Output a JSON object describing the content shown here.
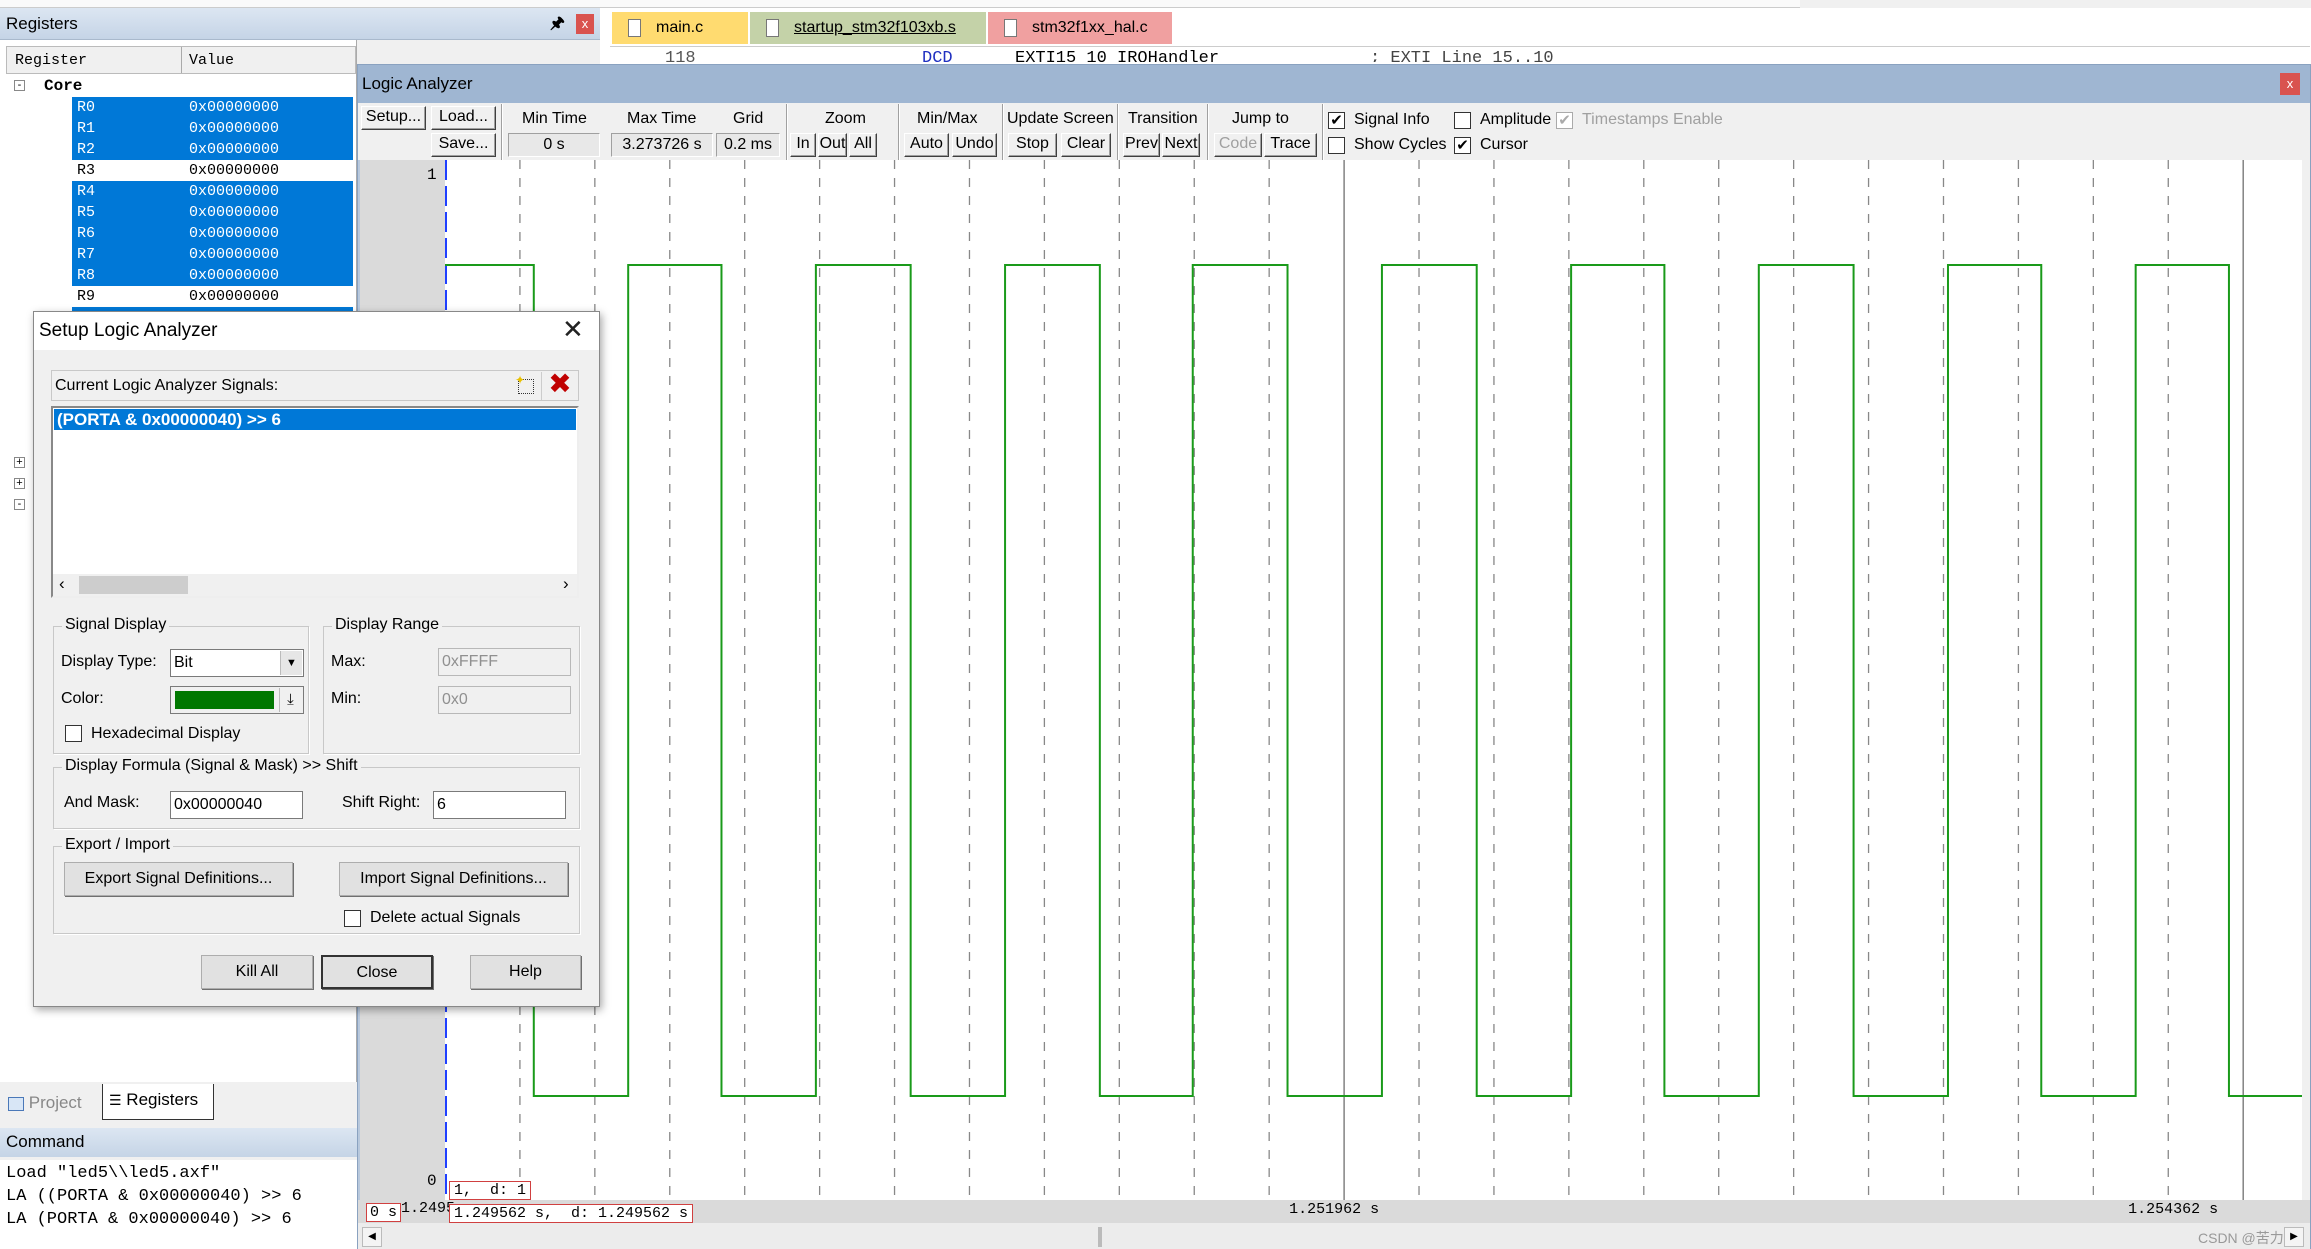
{
  "colors": {
    "selection": "#0078d7",
    "signal": "#1a9a1a",
    "panel_title": "#9fb6d2",
    "close_red": "#d9534f",
    "cursor_box": "#d04040"
  },
  "registers_panel": {
    "title": "Registers",
    "columns": [
      "Register",
      "Value"
    ],
    "group": "Core",
    "rows": [
      {
        "name": "R0",
        "value": "0x00000000",
        "selected": true
      },
      {
        "name": "R1",
        "value": "0x00000000",
        "selected": true
      },
      {
        "name": "R2",
        "value": "0x00000000",
        "selected": true
      },
      {
        "name": "R3",
        "value": "0x00000000",
        "selected": false
      },
      {
        "name": "R4",
        "value": "0x00000000",
        "selected": true
      },
      {
        "name": "R5",
        "value": "0x00000000",
        "selected": true
      },
      {
        "name": "R6",
        "value": "0x00000000",
        "selected": true
      },
      {
        "name": "R7",
        "value": "0x00000000",
        "selected": true
      },
      {
        "name": "R8",
        "value": "0x00000000",
        "selected": true
      },
      {
        "name": "R9",
        "value": "0x00000000",
        "selected": false
      }
    ],
    "bottom_tabs": [
      "Project",
      "Registers"
    ],
    "active_tab": "Registers"
  },
  "command": {
    "title": "Command",
    "lines": [
      "Load \"led5\\\\led5.axf\"",
      "LA ((PORTA & 0x00000040) >> 6",
      "LA (PORTA & 0x00000040) >> 6"
    ]
  },
  "editor": {
    "tabs": [
      "main.c",
      "startup_stm32f103xb.s",
      "stm32f1xx_hal.c"
    ],
    "active_tab": "startup_stm32f103xb.s",
    "partial_line": {
      "number": "118",
      "mnemonic": "DCD",
      "operand": "EXTI15_10_IRQHandler",
      "comment": "; EXTI Line 15..10"
    }
  },
  "logic_analyzer": {
    "title": "Logic Analyzer",
    "setup": "Setup...",
    "load": "Load...",
    "save": "Save...",
    "min_time_label": "Min Time",
    "min_time": "0 s",
    "max_time_label": "Max Time",
    "max_time": "3.273726 s",
    "grid_label": "Grid",
    "grid": "0.2 ms",
    "zoom_label": "Zoom",
    "zoom_in": "In",
    "zoom_out": "Out",
    "zoom_all": "All",
    "minmax_label": "Min/Max",
    "auto": "Auto",
    "undo": "Undo",
    "update_label": "Update Screen",
    "stop": "Stop",
    "clear": "Clear",
    "transition_label": "Transition",
    "prev": "Prev",
    "next": "Next",
    "jump_label": "Jump to",
    "code": "Code",
    "trace": "Trace",
    "checkboxes": {
      "signal_info": {
        "label": "Signal Info",
        "checked": true
      },
      "amplitude": {
        "label": "Amplitude",
        "checked": false
      },
      "timestamps": {
        "label": "Timestamps Enable",
        "checked": true,
        "disabled": true
      },
      "show_cycles": {
        "label": "Show Cycles",
        "checked": false
      },
      "cursor": {
        "label": "Cursor",
        "checked": true
      }
    },
    "start_label": "0 s",
    "start_partial": "1.2495",
    "cursor_value": "1,  d: 1",
    "cursor_time": "1.249562 s,  d: 1.249562 s",
    "watermark": "CSDN @苦力类"
  },
  "chart_data": {
    "type": "line",
    "step": true,
    "x_unit": "s",
    "xlim": [
      1.249562,
      1.254519
    ],
    "ylim": [
      0,
      1
    ],
    "y_tick_labels": [
      "1",
      "0"
    ],
    "grid": true,
    "grid_interval_s": 0.0002,
    "x_tick_labels": [
      {
        "t": 1.251962,
        "label": "1.251962 s"
      },
      {
        "t": 1.254362,
        "label": "1.254362 s"
      }
    ],
    "cursor_t": 1.249562,
    "series": [
      {
        "initial_value": 1,
        "transitions_s": [
          1.249799,
          1.250051,
          1.2503,
          1.250552,
          1.250805,
          1.251057,
          1.25131,
          1.251558,
          1.251811,
          1.252063,
          1.252316,
          1.252568,
          1.252817,
          1.253069,
          1.253322,
          1.253574,
          1.253823,
          1.254075,
          1.254324
        ]
      }
    ]
  },
  "setup_dialog": {
    "title": "Setup Logic Analyzer",
    "signals_label": "Current Logic Analyzer Signals:",
    "signals": [
      "(PORTA & 0x00000040) >> 6"
    ],
    "signal_display_title": "Signal Display",
    "display_type_label": "Display Type:",
    "display_type": "Bit",
    "color_label": "Color:",
    "color_value": "#007800",
    "hex_label": "Hexadecimal Display",
    "hex_checked": false,
    "display_range_title": "Display Range",
    "max_label": "Max:",
    "max": "0xFFFF",
    "min_label": "Min:",
    "min": "0x0",
    "formula_title": "Display Formula (Signal & Mask) >> Shift",
    "and_mask_label": "And Mask:",
    "and_mask": "0x00000040",
    "shift_label": "Shift Right:",
    "shift": "6",
    "export_title": "Export / Import",
    "export_btn": "Export Signal Definitions...",
    "import_btn": "Import Signal Definitions...",
    "delete_label": "Delete actual Signals",
    "delete_checked": false,
    "kill_all": "Kill All",
    "close": "Close",
    "help": "Help"
  }
}
